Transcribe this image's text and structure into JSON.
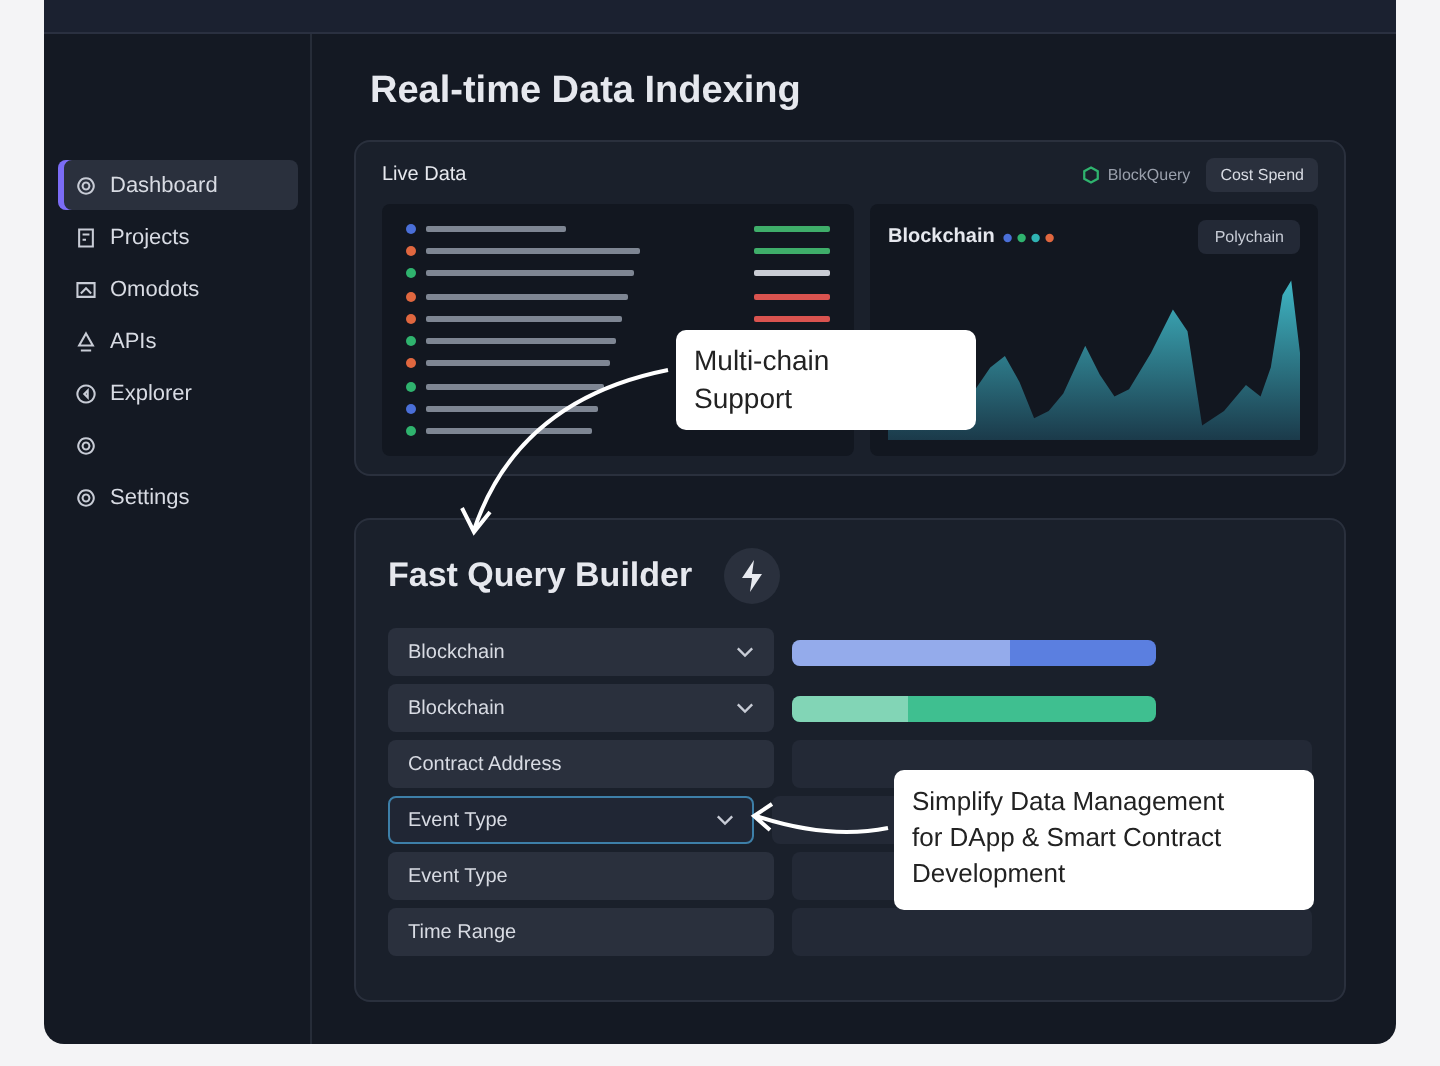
{
  "page": {
    "title": "Real-time Data Indexing"
  },
  "sidebar": {
    "items": [
      {
        "label": "Dashboard",
        "selected": true
      },
      {
        "label": "Projects",
        "selected": false
      },
      {
        "label": "Omodots",
        "selected": false
      },
      {
        "label": "APIs",
        "selected": false
      },
      {
        "label": "Explorer",
        "selected": false
      },
      {
        "selected": false
      },
      {
        "label": "Settings",
        "selected": false
      }
    ]
  },
  "live_data": {
    "title": "Live Data",
    "brand": "BlockQuery",
    "button": "Cost Spend",
    "rows": [
      {
        "color": "#4a6fd8",
        "value": {
          "color": "#3fae6a"
        }
      },
      {
        "color": "#e0673f",
        "value": {
          "color": "#3fae6a"
        }
      },
      {
        "color": "#2fb36e",
        "value": {
          "color": "#c9ccd4"
        }
      },
      {
        "color": "#e0673f",
        "value": {
          "color": "#d9534f"
        }
      },
      {
        "color": "#e0673f",
        "value": {
          "color": "#d9534f"
        }
      },
      {
        "color": "#2fb36e"
      },
      {
        "color": "#e0673f"
      },
      {
        "color": "#2fb36e"
      },
      {
        "color": "#4a6fd8"
      },
      {
        "color": "#2fb36e"
      }
    ],
    "chart": {
      "title": "Blockchain",
      "dropdown": "Polychain"
    }
  },
  "query_builder": {
    "title": "Fast Query Builder",
    "fields": [
      {
        "label": "Blockchain",
        "kind": "select",
        "focused": false,
        "bar": {
          "color": "#5b7fe0",
          "level": 0.6
        }
      },
      {
        "label": "Blockchain",
        "kind": "select",
        "focused": false,
        "bar": {
          "color": "#3fbf90",
          "level": 0.32
        }
      },
      {
        "label": "Contract Address",
        "kind": "text",
        "focused": false
      },
      {
        "label": "Event Type",
        "kind": "select",
        "focused": true
      },
      {
        "label": "Event Type",
        "kind": "text",
        "focused": false
      },
      {
        "label": "Time Range",
        "kind": "text",
        "focused": false
      }
    ]
  },
  "callouts": [
    {
      "text": "Multi-chain Support"
    },
    {
      "text": "Simplify Data Management for DApp & Smart Contract Development"
    }
  ]
}
